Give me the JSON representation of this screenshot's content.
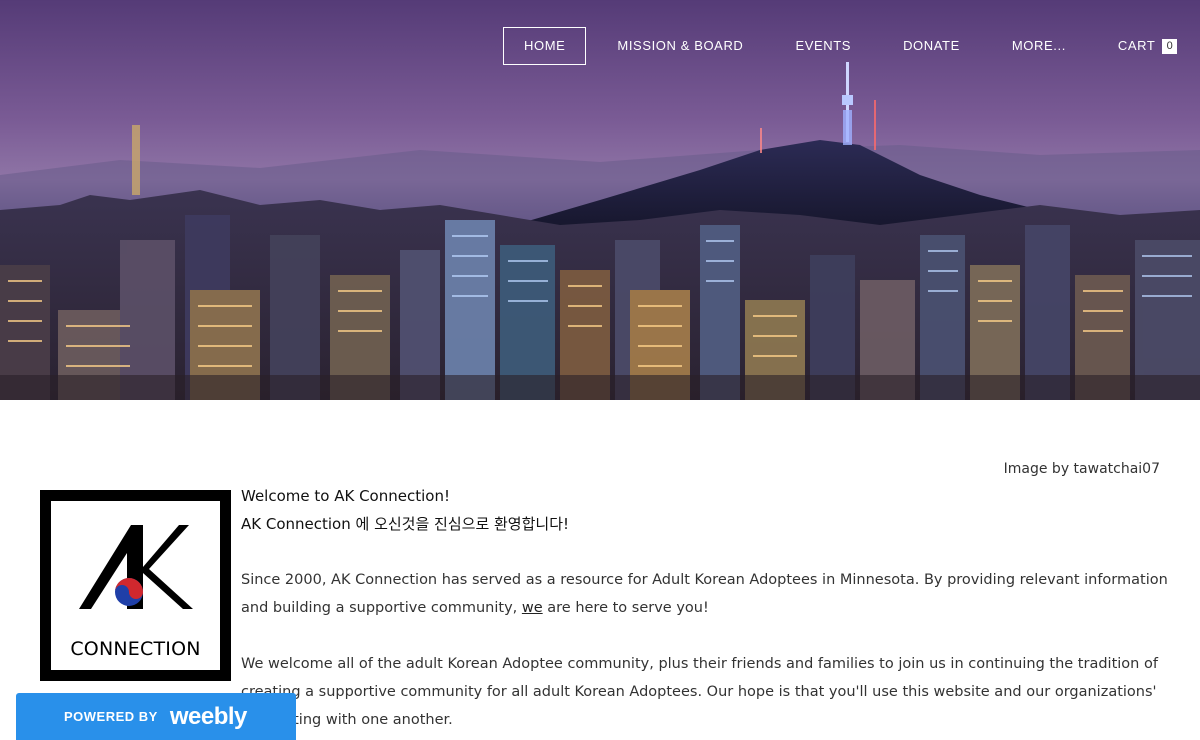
{
  "nav": {
    "items": [
      {
        "label": "HOME",
        "active": true
      },
      {
        "label": "MISSION & BOARD",
        "active": false
      },
      {
        "label": "EVENTS",
        "active": false
      },
      {
        "label": "DONATE",
        "active": false
      },
      {
        "label": "MORE...",
        "active": false
      }
    ],
    "cart_label": "CART",
    "cart_count": "0"
  },
  "hero": {
    "image_credit": "Image by tawatchai07"
  },
  "logo": {
    "text": "CONNECTION"
  },
  "content": {
    "welcome_en": "Welcome to AK Connection!",
    "welcome_ko": "AK Connection 에 오신것을 진심으로 환영합니다!",
    "para1_before": "Since 2000, AK Connection has served as a resource for Adult Korean Adoptees in Minnesota. By providing relevant information and building a supportive community, ",
    "para1_link": "we",
    "para1_after": " are here to serve you!",
    "para2": "We welcome all of the adult Korean Adoptee community, plus their friends and families to join us in continuing the tradition of creating a supportive community for all adult Korean Adoptees. Our hope is that you'll use this website and our organizations' connecting with one another."
  },
  "badge": {
    "powered_by": "POWERED BY",
    "brand": "weebly"
  },
  "colors": {
    "badge_blue": "#2990ea",
    "hero_purple": "#6e4f8c"
  }
}
